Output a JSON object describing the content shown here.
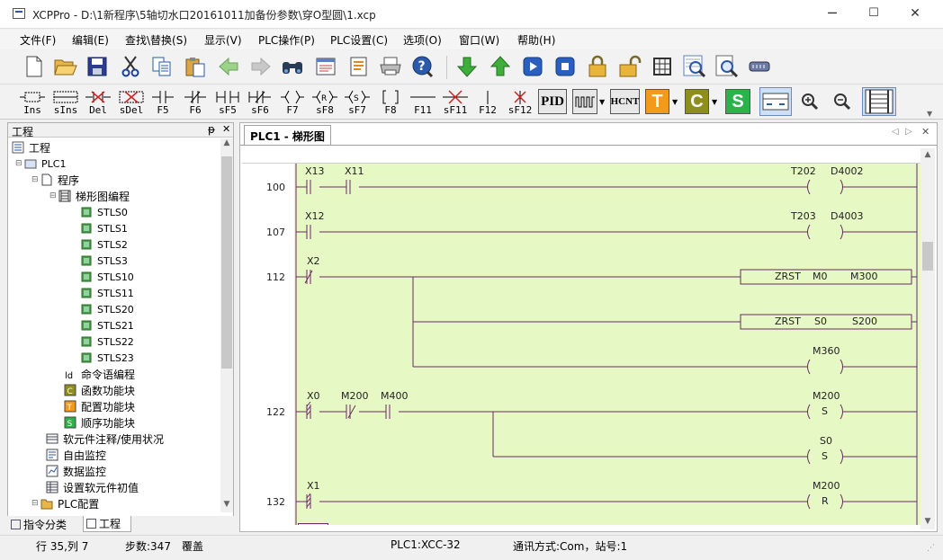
{
  "window": {
    "title": "XCPPro - D:\\1新程序\\5轴切水口20161011加备份参数\\穿O型圆\\1.xcp",
    "min": "─",
    "max": "☐",
    "close": "✕"
  },
  "menu": [
    "文件(F)",
    "编辑(E)",
    "查找\\替换(S)",
    "显示(V)",
    "PLC操作(P)",
    "PLC设置(C)",
    "选项(O)",
    "窗口(W)",
    "帮助(H)"
  ],
  "toolbar2": {
    "labels": [
      "Ins",
      "sIns",
      "Del",
      "sDel",
      "F5",
      "F6",
      "sF5",
      "sF6",
      "F7",
      "sF8",
      "sF7",
      "F8",
      "F11",
      "sF11",
      "F12",
      "sF12"
    ],
    "pid": "PID",
    "hcnt": "HCNT",
    "t": "T",
    "c": "C",
    "s": "S"
  },
  "left_panel": {
    "title": "工程",
    "pin": "ᵽ",
    "close": "✕",
    "tree": {
      "root": "工程",
      "plc": "PLC1",
      "program": "程序",
      "ladder": "梯形图编程",
      "stls": [
        "STLS0",
        "STLS1",
        "STLS2",
        "STLS3",
        "STLS10",
        "STLS11",
        "STLS20",
        "STLS21",
        "STLS22",
        "STLS23"
      ],
      "cmd": "命令语编程",
      "func": "函数功能块",
      "config_fb": "配置功能块",
      "seq_fb": "顺序功能块",
      "comment": "软元件注释/使用状况",
      "free_monitor": "自由监控",
      "data_monitor": "数据监控",
      "init": "设置软元件初值",
      "plc_config": "PLC配置"
    },
    "tabs": [
      "指令分类",
      "工程"
    ]
  },
  "document": {
    "tab": "PLC1 - 梯形图",
    "rungs": [
      {
        "no": "100",
        "contacts": [
          "X13",
          "X11"
        ],
        "out": "T202",
        "out2": "D4002"
      },
      {
        "no": "107",
        "contacts": [
          "X12"
        ],
        "out": "T203",
        "out2": "D4003"
      },
      {
        "no": "112",
        "contacts": [
          "X2"
        ],
        "zrst1": [
          "ZRST",
          "M0",
          "M300"
        ],
        "zrst2": [
          "ZRST",
          "S0",
          "S200"
        ],
        "coil": "M360"
      },
      {
        "no": "122",
        "contacts": [
          "X0",
          "M200",
          "M400"
        ],
        "coil1": "M200",
        "coil1_type": "S",
        "coil2": "S0",
        "coil2_type": "S"
      },
      {
        "no": "132",
        "contacts": [
          "X1"
        ],
        "coil": "M200",
        "coil_type": "R"
      }
    ]
  },
  "status": {
    "position": "行 35,列 7",
    "steps": "步数:347",
    "mode": "覆盖",
    "plc": "PLC1:XCC-32",
    "comm": "通讯方式:Com，站号:1"
  },
  "colors": {
    "ladder_bg": "#e6f8c4",
    "wire": "#6b2a66"
  }
}
